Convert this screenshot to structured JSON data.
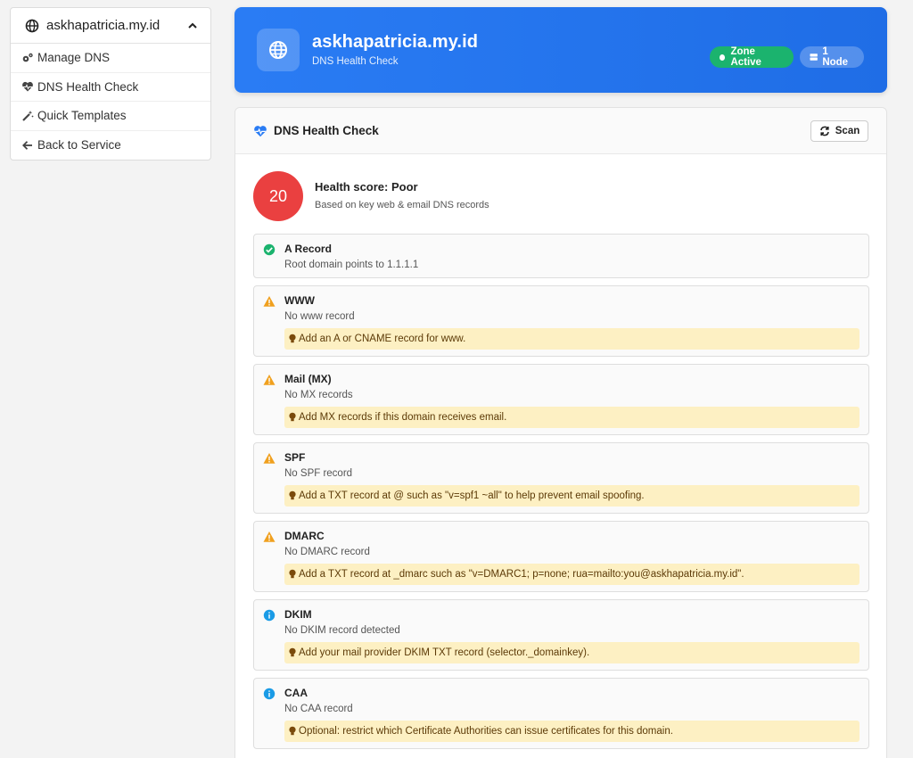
{
  "sidebar": {
    "domain": "askhapatricia.my.id",
    "items": [
      {
        "label": "Manage DNS",
        "icon": "gears-icon"
      },
      {
        "label": "DNS Health Check",
        "icon": "heartbeat-icon"
      },
      {
        "label": "Quick Templates",
        "icon": "magic-wand-icon"
      },
      {
        "label": "Back to Service",
        "icon": "arrow-left-icon"
      }
    ]
  },
  "banner": {
    "title": "askhapatricia.my.id",
    "subtitle": "DNS Health Check",
    "zone_badge": "Zone Active",
    "node_badge": "1 Node"
  },
  "panel": {
    "title": "DNS Health Check",
    "scan_label": "Scan",
    "score": "20",
    "score_title": "Health score: Poor",
    "score_sub": "Based on key web & email DNS records",
    "checks": [
      {
        "name": "A Record",
        "desc": "Root domain points to 1.1.1.1",
        "status": "ok",
        "tip": ""
      },
      {
        "name": "WWW",
        "desc": "No www record",
        "status": "warning",
        "tip": "Add an A or CNAME record for www."
      },
      {
        "name": "Mail (MX)",
        "desc": "No MX records",
        "status": "warning",
        "tip": "Add MX records if this domain receives email."
      },
      {
        "name": "SPF",
        "desc": "No SPF record",
        "status": "warning",
        "tip": "Add a TXT record at @ such as \"v=spf1 ~all\" to help prevent email spoofing."
      },
      {
        "name": "DMARC",
        "desc": "No DMARC record",
        "status": "warning",
        "tip": "Add a TXT record at _dmarc such as \"v=DMARC1; p=none; rua=mailto:you@askhapatricia.my.id\"."
      },
      {
        "name": "DKIM",
        "desc": "No DKIM record detected",
        "status": "info",
        "tip": "Add your mail provider DKIM TXT record (selector._domainkey)."
      },
      {
        "name": "CAA",
        "desc": "No CAA record",
        "status": "info",
        "tip": "Optional: restrict which Certificate Authorities can issue certificates for this domain."
      }
    ]
  },
  "colors": {
    "primary": "#2a7cf4",
    "success": "#1bb36e",
    "warning": "#f0a01e",
    "info": "#1a9be6",
    "danger": "#ea4040",
    "tip_bg": "#fdf0c3"
  }
}
